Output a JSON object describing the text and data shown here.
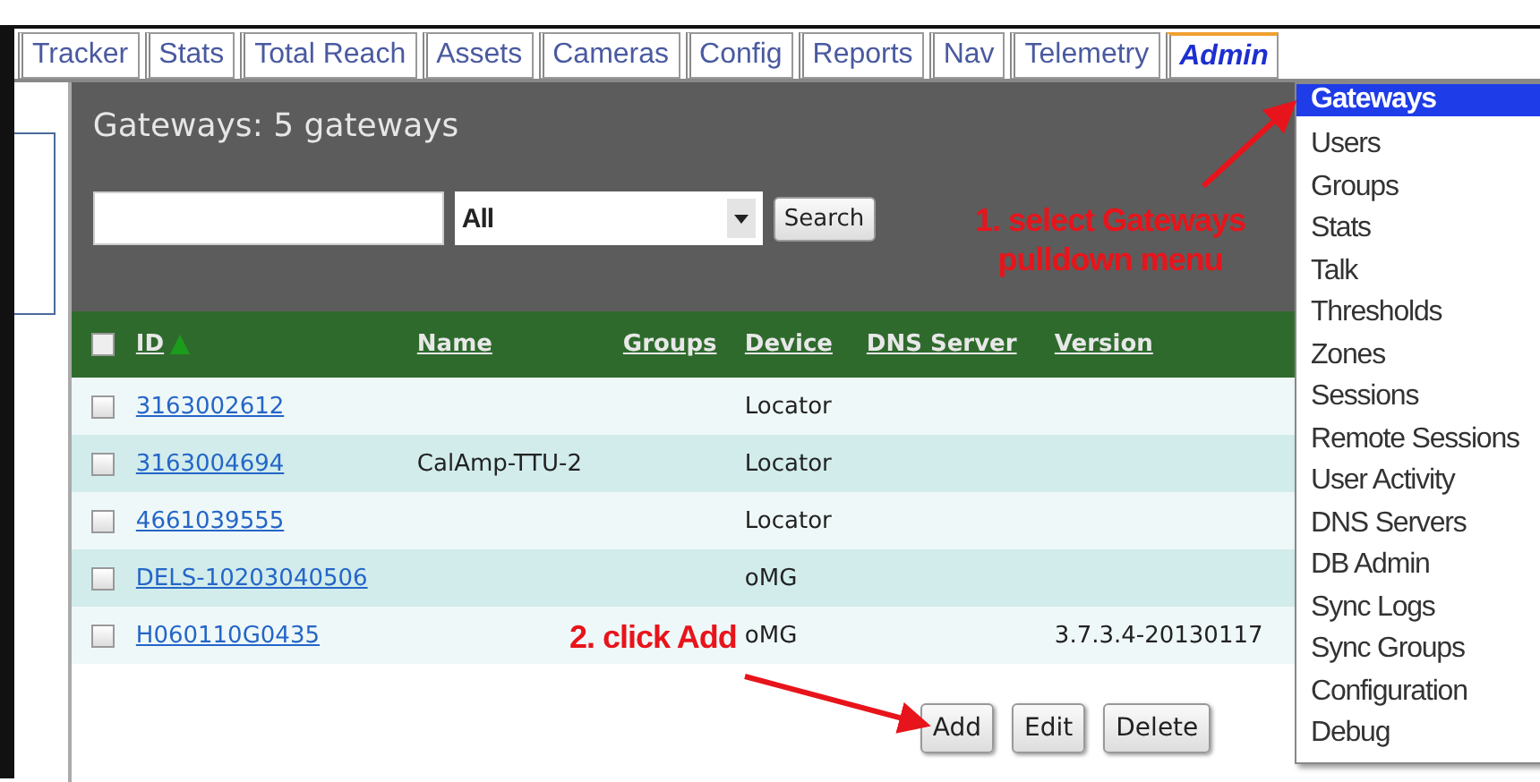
{
  "tabs": [
    {
      "label": "Tracker",
      "selected": false
    },
    {
      "label": "Stats",
      "selected": false
    },
    {
      "label": "Total Reach",
      "selected": false
    },
    {
      "label": "Assets",
      "selected": false
    },
    {
      "label": "Cameras",
      "selected": false
    },
    {
      "label": "Config",
      "selected": false
    },
    {
      "label": "Reports",
      "selected": false
    },
    {
      "label": "Nav",
      "selected": false
    },
    {
      "label": "Telemetry",
      "selected": false
    },
    {
      "label": "Admin",
      "selected": true
    }
  ],
  "panel": {
    "title": "Gateways: 5 gateways",
    "filter": {
      "value": "All"
    },
    "search_button": "Search"
  },
  "table": {
    "select_all_checked": false,
    "columns": [
      {
        "label": "ID",
        "sorted": true
      },
      {
        "label": "Name",
        "sorted": false
      },
      {
        "label": "Groups",
        "sorted": false
      },
      {
        "label": "Device",
        "sorted": false
      },
      {
        "label": "DNS Server",
        "sorted": false
      },
      {
        "label": "Version",
        "sorted": false
      }
    ],
    "rows": [
      {
        "checked": false,
        "id": "3163002612",
        "device": "Locator"
      },
      {
        "checked": false,
        "id": "3163004694",
        "name": "CalAmp-TTU-2",
        "device": "Locator"
      },
      {
        "checked": false,
        "id": "4661039555",
        "device": "Locator"
      },
      {
        "checked": false,
        "id": "DELS-10203040506",
        "device": "oMG"
      },
      {
        "checked": false,
        "id": "H060110G0435",
        "device": "oMG",
        "version": "3.7.3.4-20130117"
      }
    ]
  },
  "buttons": [
    "Add",
    "Edit",
    "Delete"
  ],
  "menu": [
    {
      "label": "Gateways",
      "selected": true
    },
    {
      "label": "Users",
      "selected": false
    },
    {
      "label": "Groups",
      "selected": false
    },
    {
      "label": "Stats",
      "selected": false
    },
    {
      "label": "Talk",
      "selected": false
    },
    {
      "label": "Thresholds",
      "selected": false
    },
    {
      "label": "Zones",
      "selected": false
    },
    {
      "label": "Sessions",
      "selected": false
    },
    {
      "label": "Remote Sessions",
      "selected": false
    },
    {
      "label": "User Activity",
      "selected": false
    },
    {
      "label": "DNS Servers",
      "selected": false
    },
    {
      "label": "DB Admin",
      "selected": false
    },
    {
      "label": "Sync Logs",
      "selected": false
    },
    {
      "label": "Sync Groups",
      "selected": false
    },
    {
      "label": "Configuration",
      "selected": false
    },
    {
      "label": "Debug",
      "selected": false
    }
  ],
  "annotations": [
    {
      "text": "1. select Gateways pulldown menu"
    },
    {
      "text": "2. click Add"
    }
  ]
}
